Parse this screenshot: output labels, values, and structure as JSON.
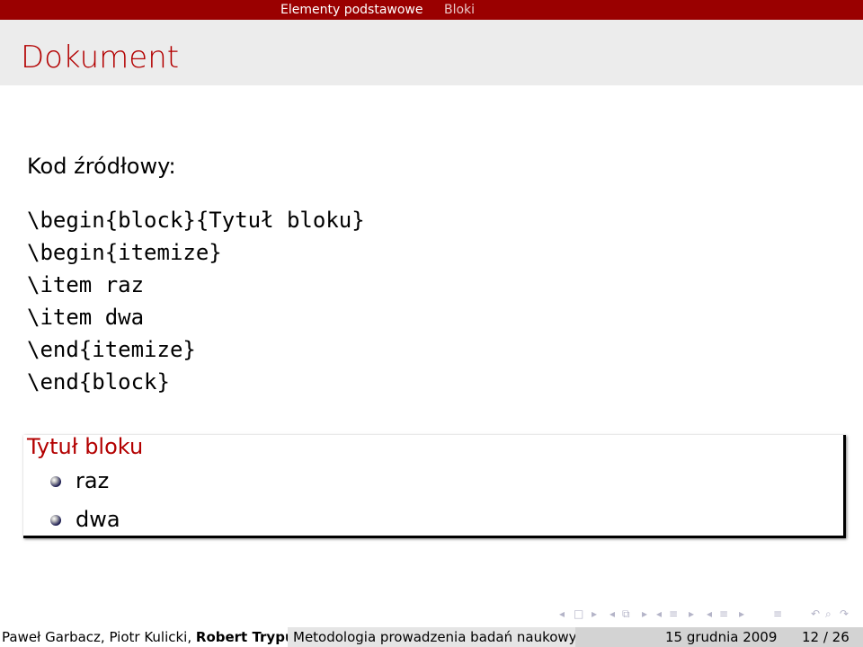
{
  "headline": {
    "section": "Elementy podstawowe",
    "subsection": "Bloki"
  },
  "frame": {
    "title": "Dokument",
    "label": "Kod źródłowy:",
    "code_lines": [
      "\\begin{block}{Tytuł bloku}",
      "\\begin{itemize}",
      "\\item raz",
      "\\item dwa",
      "\\end{itemize}",
      "\\end{block}"
    ]
  },
  "block": {
    "title": "Tytuł bloku",
    "items": [
      "raz",
      "dwa"
    ]
  },
  "navigation": {
    "icons": [
      "nav-prev-frame",
      "nav-frame",
      "nav-next-frame",
      "nav-prev-subsection",
      "nav-subsection",
      "nav-next-subsection",
      "nav-prev-section",
      "nav-section",
      "nav-next-section",
      "nav-align",
      "nav-search"
    ]
  },
  "footer": {
    "authors_plain": "Paweł Garbacz, Piotr Kulicki, ",
    "authors_bold": "Robert Trypuz",
    "talk_title": "Metodologia prowadzenia badań naukowych",
    "date": "15 grudnia 2009",
    "page": "12 / 26"
  },
  "colors": {
    "headline_bg": "#9a0000",
    "title_red": "#b30000",
    "frametitle_bg": "#ececec"
  }
}
